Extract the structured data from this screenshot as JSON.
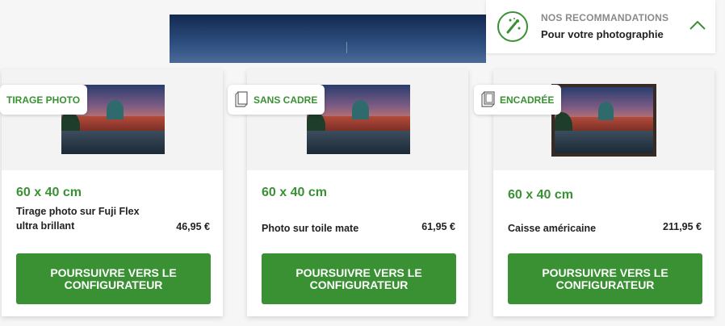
{
  "recommendations": {
    "kicker": "NOS RECOMMANDATIONS",
    "title": "Pour votre photographie",
    "icon": "magic-wand-icon",
    "toggle_icon": "chevron-up-icon"
  },
  "cards": [
    {
      "badge": "TIRAGE PHOTO",
      "size": "60 x 40 cm",
      "description": "Tirage photo sur Fuji Flex ultra brillant",
      "price": "46,95 €",
      "cta": "POURSUIVRE VERS LE CONFIGURATEUR"
    },
    {
      "badge": "SANS CADRE",
      "badge_icon": "canvas-icon",
      "size": "60 x 40 cm",
      "description": "Photo sur toile mate",
      "price": "61,95 €",
      "cta": "POURSUIVRE VERS LE CONFIGURATEUR"
    },
    {
      "badge": "ENCADRÉE",
      "badge_icon": "frame-icon",
      "size": "60 x 40 cm",
      "description": "Caisse américaine",
      "price": "211,95 €",
      "cta": "POURSUIVRE VERS LE CONFIGURATEUR"
    }
  ],
  "colors": {
    "accent": "#3a9134",
    "card_bg": "#ffffff",
    "media_bg": "#f3f3f3"
  }
}
